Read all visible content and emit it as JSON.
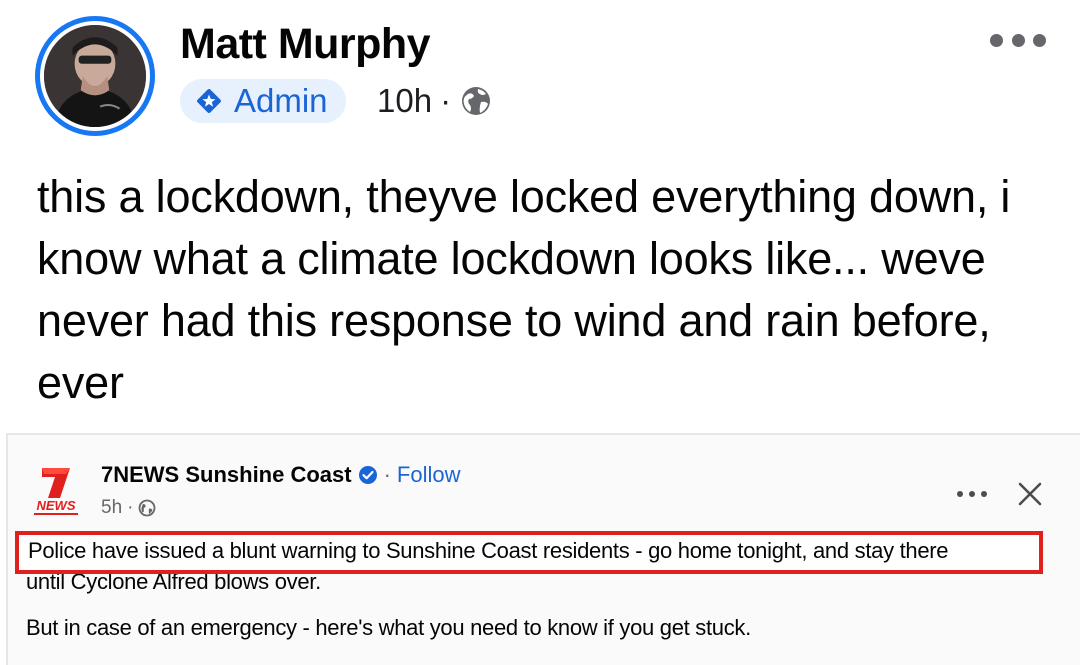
{
  "post": {
    "author_name": "Matt Murphy",
    "role_badge": "Admin",
    "timestamp": "10h",
    "separator": "·",
    "audience_icon": "globe-icon",
    "more_icon": "more-horizontal-icon",
    "text": "this a lockdown, theyve locked everything down, i know what a climate lockdown looks like... weve never had this response to wind and rain before, ever"
  },
  "shared_post": {
    "page_name": "7NEWS Sunshine Coast",
    "verified_icon": "verified-badge-icon",
    "separator": "·",
    "follow_label": "Follow",
    "timestamp": "5h",
    "meta_separator": "·",
    "logo_text": "7 NEWS",
    "line1": "Police have issued a blunt warning to Sunshine Coast residents - go home tonight, and stay there",
    "line2": "until Cyclone Alfred blows over.",
    "line3": "But in case of an emergency - here's what you need to know if you get stuck."
  },
  "colors": {
    "accent_blue": "#1877f2",
    "link_blue": "#1a65d6",
    "highlight_red": "#e0201d",
    "badge_bg": "#e7f0fd"
  }
}
